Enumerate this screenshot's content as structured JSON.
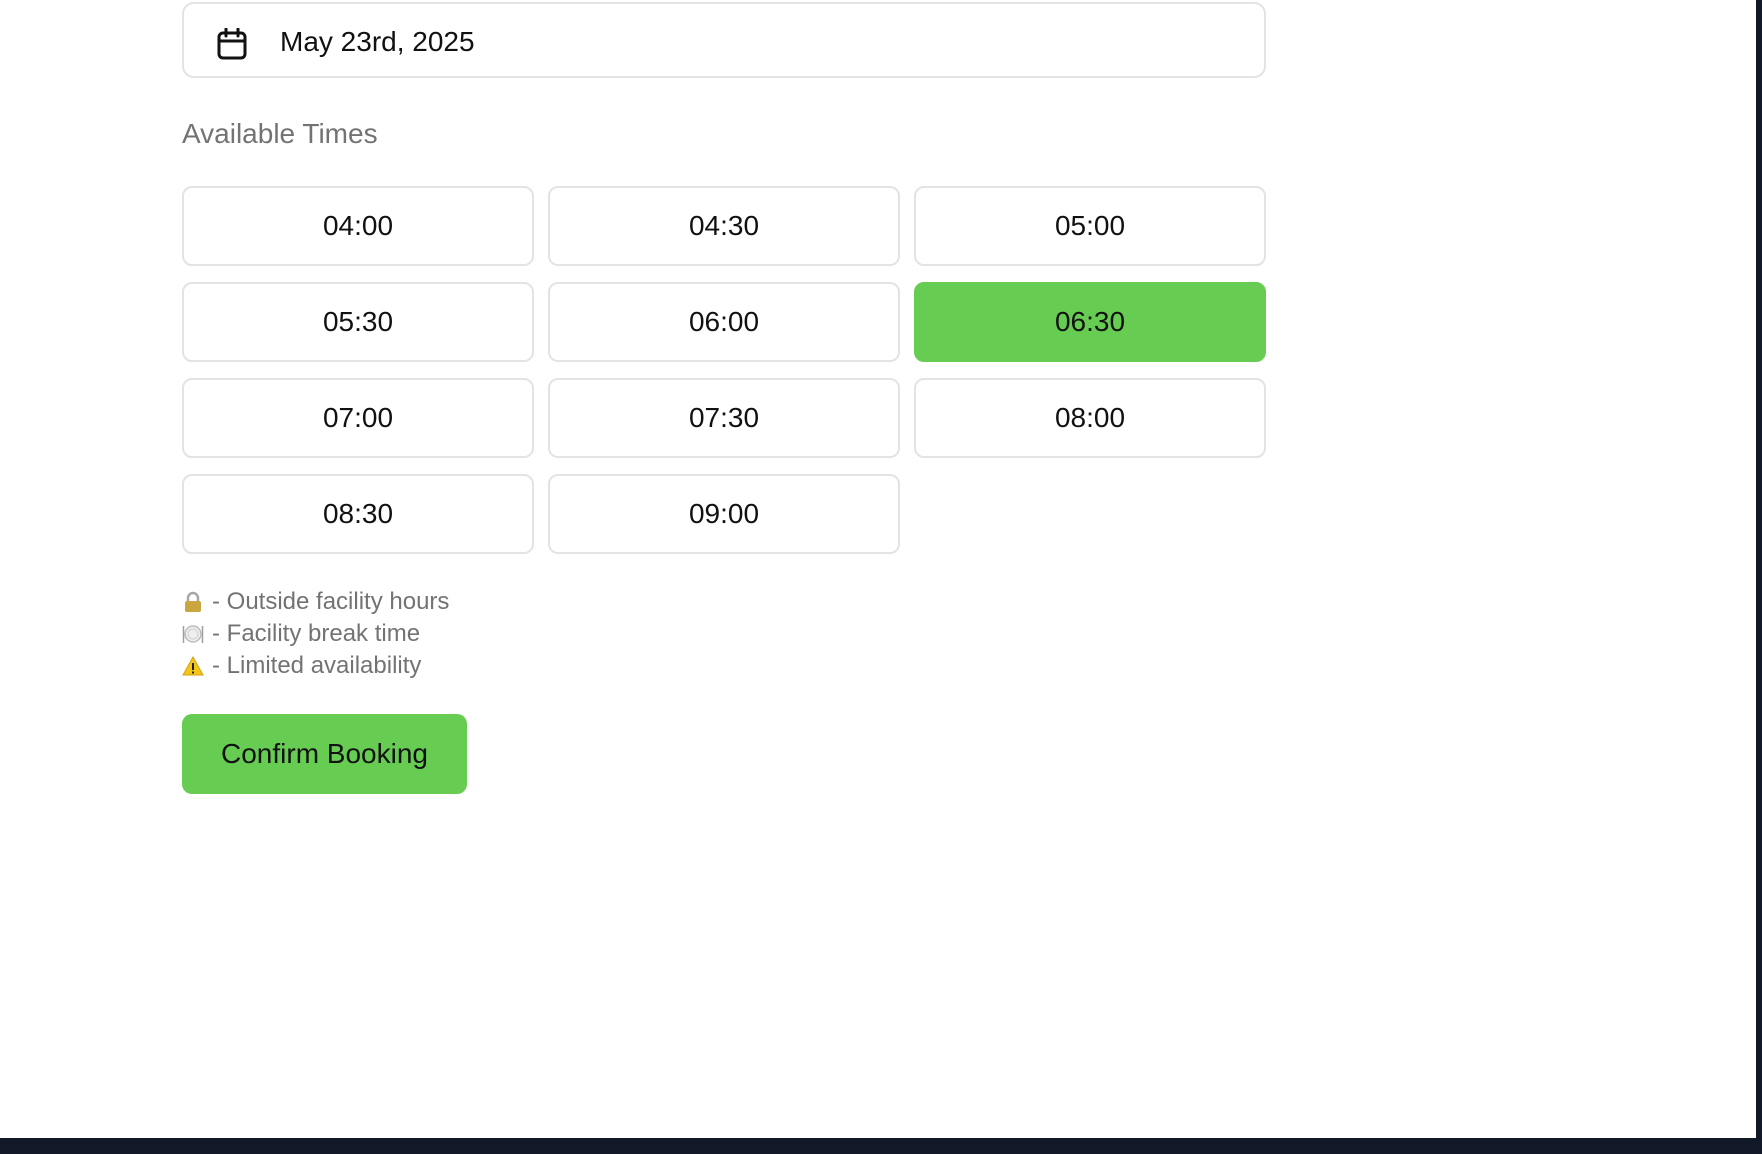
{
  "booking": {
    "date": "May 23rd, 2025",
    "section_title": "Available Times",
    "time_slots": [
      {
        "label": "04:00",
        "selected": false
      },
      {
        "label": "04:30",
        "selected": false
      },
      {
        "label": "05:00",
        "selected": false
      },
      {
        "label": "05:30",
        "selected": false
      },
      {
        "label": "06:00",
        "selected": false
      },
      {
        "label": "06:30",
        "selected": true
      },
      {
        "label": "07:00",
        "selected": false
      },
      {
        "label": "07:30",
        "selected": false
      },
      {
        "label": "08:00",
        "selected": false
      },
      {
        "label": "08:30",
        "selected": false
      },
      {
        "label": "09:00",
        "selected": false
      }
    ],
    "legend": [
      {
        "icon": "lock-icon",
        "text": "- Outside facility hours"
      },
      {
        "icon": "plate-icon",
        "text": "- Facility break time"
      },
      {
        "icon": "warning-icon",
        "text": "- Limited availability"
      }
    ],
    "confirm_label": "Confirm Booking"
  },
  "colors": {
    "accent": "#66cc52",
    "border": "#e3e3e3",
    "muted_text": "#737373",
    "text": "#111111",
    "page_background": "#ffffff",
    "frame_background": "#111827"
  }
}
